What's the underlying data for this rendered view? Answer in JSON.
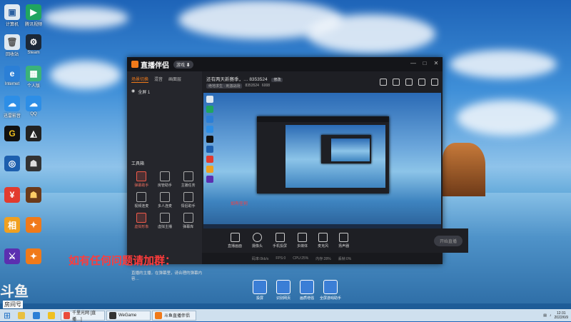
{
  "desktop": {
    "icons_left": [
      {
        "label": "计算机",
        "icon": "computer-icon",
        "color": "#dfe8f0"
      },
      {
        "label": "回收站",
        "icon": "recycle-bin-icon",
        "color": "#dfe8f0"
      },
      {
        "label": "Internet",
        "icon": "ie-icon",
        "color": "#2b7fd6"
      },
      {
        "label": "迅雷影音",
        "icon": "cloud-icon",
        "color": "#2d8ee6"
      },
      {
        "label": "",
        "icon": "g-app-icon",
        "color": "#111111"
      },
      {
        "label": "",
        "icon": "blue-app-icon",
        "color": "#1d5fae"
      },
      {
        "label": "",
        "icon": "yen-icon",
        "color": "#e23b2e"
      },
      {
        "label": "",
        "icon": "orange-app-icon",
        "color": "#f0a020"
      },
      {
        "label": "",
        "icon": "purple-app-icon",
        "color": "#5b2fb0"
      }
    ],
    "icons_right": [
      {
        "label": "腾讯视频",
        "icon": "play-icon",
        "color": "#20a560"
      },
      {
        "label": "Steam",
        "icon": "steam-icon",
        "color": "#1b2838"
      },
      {
        "label": "个人版",
        "icon": "app-icon",
        "color": "#3bb27a"
      },
      {
        "label": "QQ",
        "icon": "cloud-icon",
        "color": "#2d8ee6"
      },
      {
        "label": "",
        "icon": "shark-icon",
        "color": "#222222"
      },
      {
        "label": "",
        "icon": "game-icon",
        "color": "#333333"
      },
      {
        "label": "",
        "icon": "game-icon",
        "color": "#6b3a1a"
      },
      {
        "label": "",
        "icon": "fox-icon",
        "color": "#f07a1a"
      },
      {
        "label": "",
        "icon": "fox-icon",
        "color": "#f07a1a"
      }
    ],
    "overlay_red_text": "如有任何问题请加群：",
    "quick_buttons": [
      "投屏",
      "识别网页",
      "画质增强",
      "全屏游戏助手"
    ],
    "douyu_brand": "斗鱼",
    "douyu_room_label": "房间号",
    "douyu_room_number": "8353524"
  },
  "window": {
    "app_name": "直播伴侣",
    "version_badge": "游戏 ⬇",
    "controls": [
      "minimize",
      "maximize",
      "close"
    ],
    "left_tabs": [
      "场景切换",
      "混音",
      "画面层"
    ],
    "scene_label": "全屏 1",
    "tools_header": "工具箱",
    "tools": [
      {
        "label": "弹幕助手",
        "red": true
      },
      {
        "label": "房管助手",
        "red": false
      },
      {
        "label": "主播任务",
        "red": false
      },
      {
        "label": "视频连麦",
        "red": false
      },
      {
        "label": "多人连麦",
        "red": false
      },
      {
        "label": "情侣助手",
        "red": false
      },
      {
        "label": "虚拟形象",
        "red": true
      },
      {
        "label": "虚拟主播",
        "red": false
      },
      {
        "label": "弹幕库",
        "red": false
      }
    ],
    "notice_text": "直播的主播，在弹幕里，请合理的弹幕内容…",
    "room_title": "还有两天新赛季，…",
    "room_number": "8353524",
    "edit_label": "修改",
    "category_chip": "绝地求生 · 刺激战场",
    "fans": "6008",
    "preview_red_text": "如有任何",
    "control_labels": [
      "直播画面",
      "摄像头",
      "手机投屏",
      "多媒体",
      "麦克风",
      "扬声器"
    ],
    "start_label": "开始直播",
    "status_items": [
      "码率:0kb/s",
      "FPS:0",
      "CPU:25%",
      "内存:28%",
      "丢帧:0%"
    ]
  },
  "taskbar": {
    "items": [
      {
        "label": "",
        "icon": "explorer-icon"
      },
      {
        "label": "",
        "icon": "media-icon"
      },
      {
        "label": "",
        "icon": "chrome-icon"
      },
      {
        "label": "",
        "icon": "store-icon"
      },
      {
        "label": "千里光网 [直播…]",
        "icon": "chrome-icon"
      },
      {
        "label": "WeGame",
        "icon": "wegame-icon"
      },
      {
        "label": "斗鱼直播伴侣",
        "icon": "fox-icon"
      }
    ],
    "time": "12:31",
    "date": "2022/6/9"
  }
}
